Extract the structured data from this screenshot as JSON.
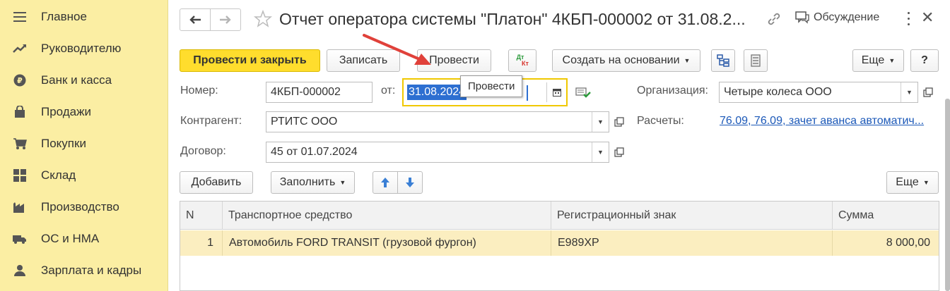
{
  "sidebar": {
    "items": [
      {
        "label": "Главное",
        "icon": "menu-icon"
      },
      {
        "label": "Руководителю",
        "icon": "trend-icon"
      },
      {
        "label": "Банк и касса",
        "icon": "ruble-coin-icon"
      },
      {
        "label": "Продажи",
        "icon": "shopping-bag-icon"
      },
      {
        "label": "Покупки",
        "icon": "cart-icon"
      },
      {
        "label": "Склад",
        "icon": "warehouse-icon"
      },
      {
        "label": "Производство",
        "icon": "factory-icon"
      },
      {
        "label": "ОС и НМА",
        "icon": "truck-icon"
      },
      {
        "label": "Зарплата и кадры",
        "icon": "person-icon"
      }
    ]
  },
  "header": {
    "title": "Отчет оператора системы \"Платон\" 4КБП-000002 от 31.08.2...",
    "discussion_label": "Обсуждение"
  },
  "toolbar": {
    "post_and_close": "Провести и закрыть",
    "save": "Записать",
    "post": "Провести",
    "dt_kt_top": "Дт",
    "dt_kt_bottom": "Кт",
    "create_based_on": "Создать на основании",
    "more": "Еще",
    "help": "?",
    "tooltip": "Провести"
  },
  "form": {
    "number_label": "Номер:",
    "number_value": "4КБП-000002",
    "date_label": "от:",
    "date_value": "31.08.2024",
    "org_label": "Организация:",
    "org_value": "Четыре колеса ООО",
    "contractor_label": "Контрагент:",
    "contractor_value": "РТИТС ООО",
    "settlements_label": "Расчеты:",
    "settlements_value": "76.09, 76.09, зачет аванса автоматич...",
    "contract_label": "Договор:",
    "contract_value": "45 от 01.07.2024"
  },
  "table_toolbar": {
    "add": "Добавить",
    "fill": "Заполнить",
    "more": "Еще"
  },
  "table": {
    "columns": [
      "N",
      "Транспортное средство",
      "Регистрационный знак",
      "Сумма"
    ],
    "rows": [
      {
        "n": "1",
        "vehicle": "Автомобиль FORD TRANSIT (грузовой фургон)",
        "plate": "Е989ХР",
        "sum": "8 000,00"
      }
    ]
  },
  "colors": {
    "sidebar_bg": "#fbeea3",
    "primary_button": "#ffdd2d",
    "selected_row": "#fbeec0",
    "link": "#1b58b8",
    "focus_border": "#f0c800",
    "arrow_annotation": "#e0413a"
  }
}
